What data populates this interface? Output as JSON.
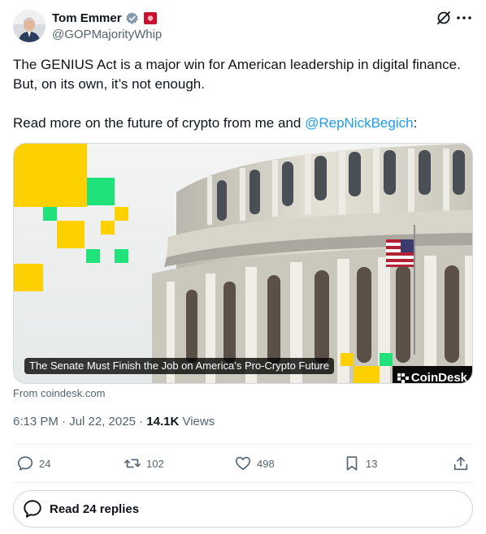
{
  "author": {
    "name": "Tom Emmer",
    "handle": "@GOPMajorityWhip",
    "verified_color": "#829aab",
    "badge_color": "#c8102e"
  },
  "tweet": {
    "line1": "The GENIUS Act is a major win for American leadership in digital finance. But, on its own, it’s not enough.",
    "line2_prefix": "Read more on the future of crypto from me and ",
    "mention": "@RepNickBegich",
    "line2_suffix": ":"
  },
  "card": {
    "caption": "The Senate Must Finish the Job on America’s Pro-Crypto Future",
    "brand": "CoinDesk",
    "source": "From coindesk.com",
    "accent_yellow": "#ffd000",
    "accent_green": "#1fe27a"
  },
  "meta": {
    "time": "6:13 PM · Jul 22, 2025 · ",
    "views_count": "14.1K",
    "views_label": " Views"
  },
  "actions": {
    "replies": "24",
    "reposts": "102",
    "likes": "498",
    "bookmarks": "13"
  },
  "read_replies": "Read 24 replies",
  "colors": {
    "text": "#0f1419",
    "secondary": "#536471",
    "link": "#1d9bf0",
    "border": "#cfd9de"
  }
}
